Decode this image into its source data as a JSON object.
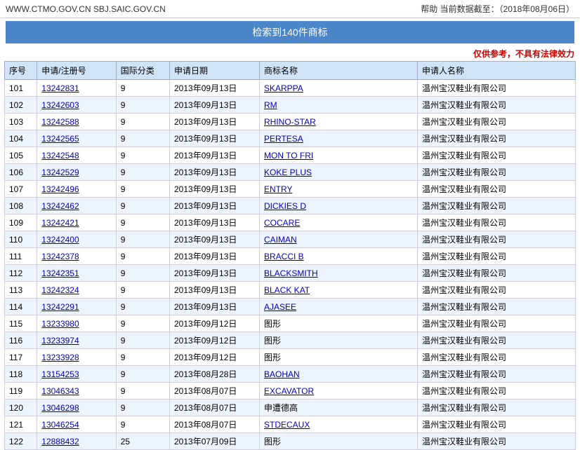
{
  "topbar": {
    "left": "WWW.CTMO.GOV.CN  SBJ.SAIC.GOV.CN",
    "right": "帮助    当前数据截至：（2018年08月06日）"
  },
  "result_bar": "检索到140件商标",
  "warning": "仅供参考，不具有法律效力",
  "table": {
    "headers": [
      "序号",
      "申请/注册号",
      "国际分类",
      "申请日期",
      "商标名称",
      "申请人名称"
    ],
    "rows": [
      [
        "101",
        "13242831",
        "9",
        "2013年09月13日",
        "SKARPPA",
        "温州宝汉鞋业有限公司"
      ],
      [
        "102",
        "13242603",
        "9",
        "2013年09月13日",
        "RM",
        "温州宝汉鞋业有限公司"
      ],
      [
        "103",
        "13242588",
        "9",
        "2013年09月13日",
        "RHINO-STAR",
        "温州宝汉鞋业有限公司"
      ],
      [
        "104",
        "13242565",
        "9",
        "2013年09月13日",
        "PERTESA",
        "温州宝汉鞋业有限公司"
      ],
      [
        "105",
        "13242548",
        "9",
        "2013年09月13日",
        "MON TO FRI",
        "温州宝汉鞋业有限公司"
      ],
      [
        "106",
        "13242529",
        "9",
        "2013年09月13日",
        "KOKE PLUS",
        "温州宝汉鞋业有限公司"
      ],
      [
        "107",
        "13242496",
        "9",
        "2013年09月13日",
        "ENTRY",
        "温州宝汉鞋业有限公司"
      ],
      [
        "108",
        "13242462",
        "9",
        "2013年09月13日",
        "DICKIES D",
        "温州宝汉鞋业有限公司"
      ],
      [
        "109",
        "13242421",
        "9",
        "2013年09月13日",
        "COCARE",
        "温州宝汉鞋业有限公司"
      ],
      [
        "110",
        "13242400",
        "9",
        "2013年09月13日",
        "CAIMAN",
        "温州宝汉鞋业有限公司"
      ],
      [
        "111",
        "13242378",
        "9",
        "2013年09月13日",
        "BRACCI B",
        "温州宝汉鞋业有限公司"
      ],
      [
        "112",
        "13242351",
        "9",
        "2013年09月13日",
        "BLACKSMITH",
        "温州宝汉鞋业有限公司"
      ],
      [
        "113",
        "13242324",
        "9",
        "2013年09月13日",
        "BLACK KAT",
        "温州宝汉鞋业有限公司"
      ],
      [
        "114",
        "13242291",
        "9",
        "2013年09月13日",
        "AJASEE",
        "温州宝汉鞋业有限公司"
      ],
      [
        "115",
        "13233980",
        "9",
        "2013年09月12日",
        "图形",
        "温州宝汉鞋业有限公司"
      ],
      [
        "116",
        "13233974",
        "9",
        "2013年09月12日",
        "图形",
        "温州宝汉鞋业有限公司"
      ],
      [
        "117",
        "13233928",
        "9",
        "2013年09月12日",
        "图形",
        "温州宝汉鞋业有限公司"
      ],
      [
        "118",
        "13154253",
        "9",
        "2013年08月28日",
        "BAOHAN",
        "温州宝汉鞋业有限公司"
      ],
      [
        "119",
        "13046343",
        "9",
        "2013年08月07日",
        "EXCAVATOR",
        "温州宝汉鞋业有限公司"
      ],
      [
        "120",
        "13046298",
        "9",
        "2013年08月07日",
        "申遭德高",
        "温州宝汉鞋业有限公司"
      ],
      [
        "121",
        "13046254",
        "9",
        "2013年08月07日",
        "STDECAUX",
        "温州宝汉鞋业有限公司"
      ],
      [
        "122",
        "12888432",
        "25",
        "2013年07月09日",
        "图形",
        "温州宝汉鞋业有限公司"
      ]
    ],
    "link_col": 1,
    "link_name_col": 4
  }
}
